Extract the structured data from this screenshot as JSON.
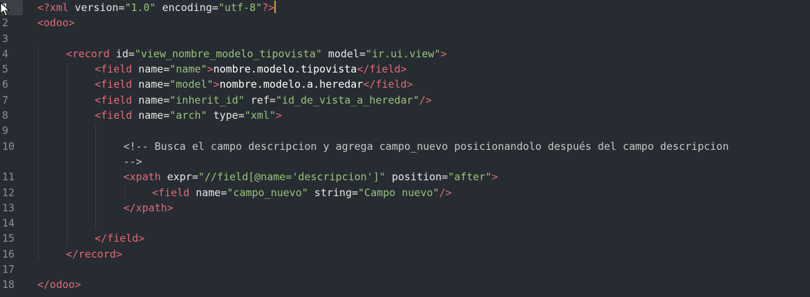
{
  "editor": {
    "active_line": 1,
    "lines": [
      {
        "n": "1",
        "indent": 0,
        "tokens": [
          {
            "c": "tag",
            "t": "<?xml"
          },
          {
            "c": "attr",
            "t": " version="
          },
          {
            "c": "str",
            "t": "\"1.0\""
          },
          {
            "c": "attr",
            "t": " encoding="
          },
          {
            "c": "str",
            "t": "\"utf-8\""
          },
          {
            "c": "tag",
            "t": "?>"
          }
        ]
      },
      {
        "n": "2",
        "indent": 0,
        "tokens": [
          {
            "c": "tag",
            "t": "<odoo>"
          }
        ]
      },
      {
        "n": "3",
        "indent": 0,
        "tokens": []
      },
      {
        "n": "4",
        "indent": 1,
        "tokens": [
          {
            "c": "tag",
            "t": "<record"
          },
          {
            "c": "attr",
            "t": " id="
          },
          {
            "c": "str",
            "t": "\"view_nombre_modelo_tipovista\""
          },
          {
            "c": "attr",
            "t": " model="
          },
          {
            "c": "str",
            "t": "\"ir.ui.view\""
          },
          {
            "c": "tag",
            "t": ">"
          }
        ]
      },
      {
        "n": "5",
        "indent": 2,
        "tokens": [
          {
            "c": "tag",
            "t": "<field"
          },
          {
            "c": "attr",
            "t": " name="
          },
          {
            "c": "str",
            "t": "\"name\""
          },
          {
            "c": "tag",
            "t": ">"
          },
          {
            "c": "text",
            "t": "nombre.modelo.tipovista"
          },
          {
            "c": "tag",
            "t": "</field>"
          }
        ]
      },
      {
        "n": "6",
        "indent": 2,
        "tokens": [
          {
            "c": "tag",
            "t": "<field"
          },
          {
            "c": "attr",
            "t": " name="
          },
          {
            "c": "str",
            "t": "\"model\""
          },
          {
            "c": "tag",
            "t": ">"
          },
          {
            "c": "text",
            "t": "nombre.modelo.a.heredar"
          },
          {
            "c": "tag",
            "t": "</field>"
          }
        ]
      },
      {
        "n": "7",
        "indent": 2,
        "tokens": [
          {
            "c": "tag",
            "t": "<field"
          },
          {
            "c": "attr",
            "t": " name="
          },
          {
            "c": "str",
            "t": "\"inherit_id\""
          },
          {
            "c": "attr",
            "t": " ref="
          },
          {
            "c": "str",
            "t": "\"id_de_vista_a_heredar\""
          },
          {
            "c": "tag",
            "t": "/>"
          }
        ]
      },
      {
        "n": "8",
        "indent": 2,
        "tokens": [
          {
            "c": "tag",
            "t": "<field"
          },
          {
            "c": "attr",
            "t": " name="
          },
          {
            "c": "str",
            "t": "\"arch\""
          },
          {
            "c": "attr",
            "t": " type="
          },
          {
            "c": "str",
            "t": "\"xml\""
          },
          {
            "c": "tag",
            "t": ">"
          }
        ]
      },
      {
        "n": "9",
        "indent": 0,
        "tokens": []
      },
      {
        "n": "10",
        "indent": 3,
        "tokens": [
          {
            "c": "comment",
            "t": "<!-- Busca el campo descripcion y agrega campo_nuevo posicionandolo después del campo descripcion"
          }
        ]
      },
      {
        "n": "",
        "indent": 3,
        "tokens": [
          {
            "c": "comment",
            "t": "-->"
          }
        ]
      },
      {
        "n": "11",
        "indent": 3,
        "tokens": [
          {
            "c": "tag",
            "t": "<xpath"
          },
          {
            "c": "attr",
            "t": " expr="
          },
          {
            "c": "str",
            "t": "\"//field[@name='descripcion']\""
          },
          {
            "c": "attr",
            "t": " position="
          },
          {
            "c": "str",
            "t": "\"after\""
          },
          {
            "c": "tag",
            "t": ">"
          }
        ]
      },
      {
        "n": "12",
        "indent": 4,
        "tokens": [
          {
            "c": "tag",
            "t": "<field"
          },
          {
            "c": "attr",
            "t": " name="
          },
          {
            "c": "str",
            "t": "\"campo_nuevo\""
          },
          {
            "c": "attr",
            "t": " string="
          },
          {
            "c": "str",
            "t": "\"Campo nuevo\""
          },
          {
            "c": "tag",
            "t": "/>"
          }
        ]
      },
      {
        "n": "13",
        "indent": 3,
        "tokens": [
          {
            "c": "tag",
            "t": "</xpath>"
          }
        ]
      },
      {
        "n": "14",
        "indent": 0,
        "tokens": []
      },
      {
        "n": "15",
        "indent": 2,
        "tokens": [
          {
            "c": "tag",
            "t": "</field>"
          }
        ]
      },
      {
        "n": "16",
        "indent": 1,
        "tokens": [
          {
            "c": "tag",
            "t": "</record>"
          }
        ]
      },
      {
        "n": "17",
        "indent": 0,
        "tokens": []
      },
      {
        "n": "18",
        "indent": 0,
        "tokens": [
          {
            "c": "tag",
            "t": "</odoo>"
          }
        ]
      }
    ]
  },
  "colors": {
    "background": "#272b32",
    "tag": "#e06c75",
    "string": "#98c379",
    "line_number": "#8a8f99",
    "cursor": "#e0a030"
  },
  "icons": {
    "pointer": "mouse-pointer-icon"
  }
}
